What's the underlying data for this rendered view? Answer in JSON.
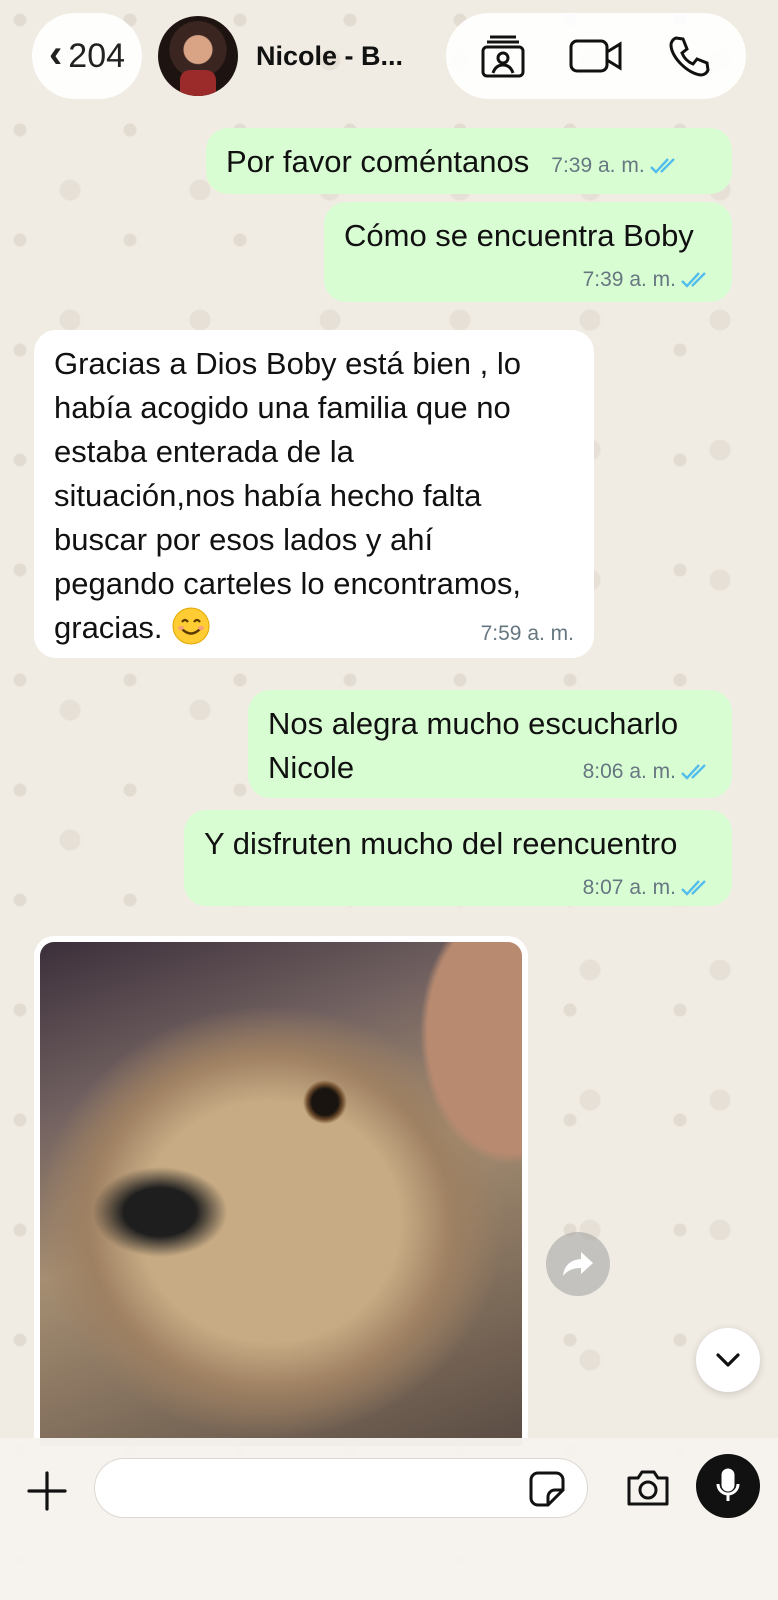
{
  "header": {
    "back_count": "204",
    "contact_name": "Nicole - B..."
  },
  "messages": [
    {
      "direction": "out",
      "text": "Por favor coméntanos",
      "time": "7:39 a. m.",
      "status": "read"
    },
    {
      "direction": "out",
      "text": "Cómo se encuentra Boby",
      "time": "7:39 a. m.",
      "status": "read"
    },
    {
      "direction": "in",
      "text_lines": [
        "Gracias a Dios Boby está bien , lo",
        "había acogido una familia que no",
        "estaba enterada de la",
        "situación,nos había hecho falta",
        "buscar por esos lados y ahí",
        "pegando carteles lo encontramos,",
        "gracias."
      ],
      "emoji": "smiling-face",
      "time": "7:59 a. m."
    },
    {
      "direction": "out",
      "text_lines": [
        "Nos alegra mucho escucharlo",
        "Nicole"
      ],
      "time": "8:06 a. m.",
      "status": "read"
    },
    {
      "direction": "out",
      "text": "Y disfruten mucho del reencuentro",
      "time": "8:07 a. m.",
      "status": "read"
    },
    {
      "direction": "in",
      "type": "image",
      "description_icon": "photo-dog"
    }
  ],
  "composer": {
    "input_value": ""
  },
  "colors": {
    "outgoing_bubble": "#d9fdd3",
    "incoming_bubble": "#ffffff",
    "read_tick": "#53bdeb",
    "chat_background": "#efeae2"
  },
  "icons": {
    "back": "chevron-left-icon",
    "contact_card": "contact-card-icon",
    "video": "video-camera-icon",
    "call": "phone-icon",
    "forward": "forward-icon",
    "scroll": "chevron-down-icon",
    "attach": "plus-icon",
    "sticker": "sticker-icon",
    "camera": "camera-icon",
    "mic": "microphone-icon"
  }
}
